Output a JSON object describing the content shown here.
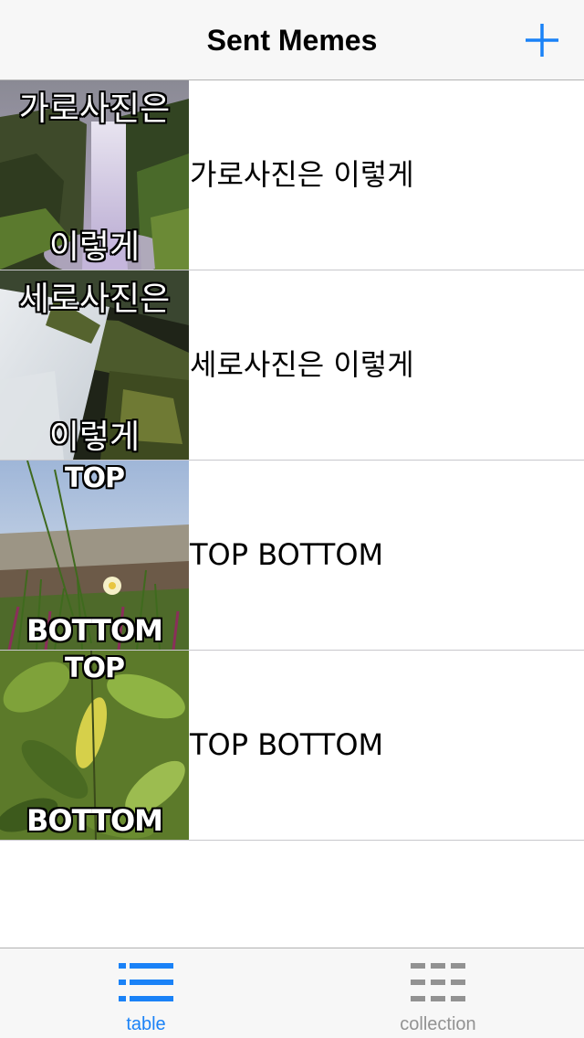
{
  "nav": {
    "title": "Sent Memes",
    "add_icon": "plus-icon",
    "accent_color": "#1a82f7"
  },
  "memes": [
    {
      "top": "가로사진은",
      "bottom": "이렇게",
      "label": "가로사진은 이렇게",
      "scene": "waterfall-tall"
    },
    {
      "top": "세로사진은",
      "bottom": "이렇게",
      "label": "세로사진은 이렇게",
      "scene": "cascade"
    },
    {
      "top": "TOP",
      "bottom": "BOTTOM",
      "label": "TOP BOTTOM",
      "scene": "beach-flower"
    },
    {
      "top": "TOP",
      "bottom": "BOTTOM",
      "label": "TOP BOTTOM",
      "scene": "green-leaves"
    }
  ],
  "tabbar": {
    "tabs": [
      {
        "label": "table",
        "icon": "list-icon",
        "active": true
      },
      {
        "label": "collection",
        "icon": "grid-icon",
        "active": false
      }
    ],
    "active_color": "#1a82f7",
    "inactive_color": "#929292"
  }
}
